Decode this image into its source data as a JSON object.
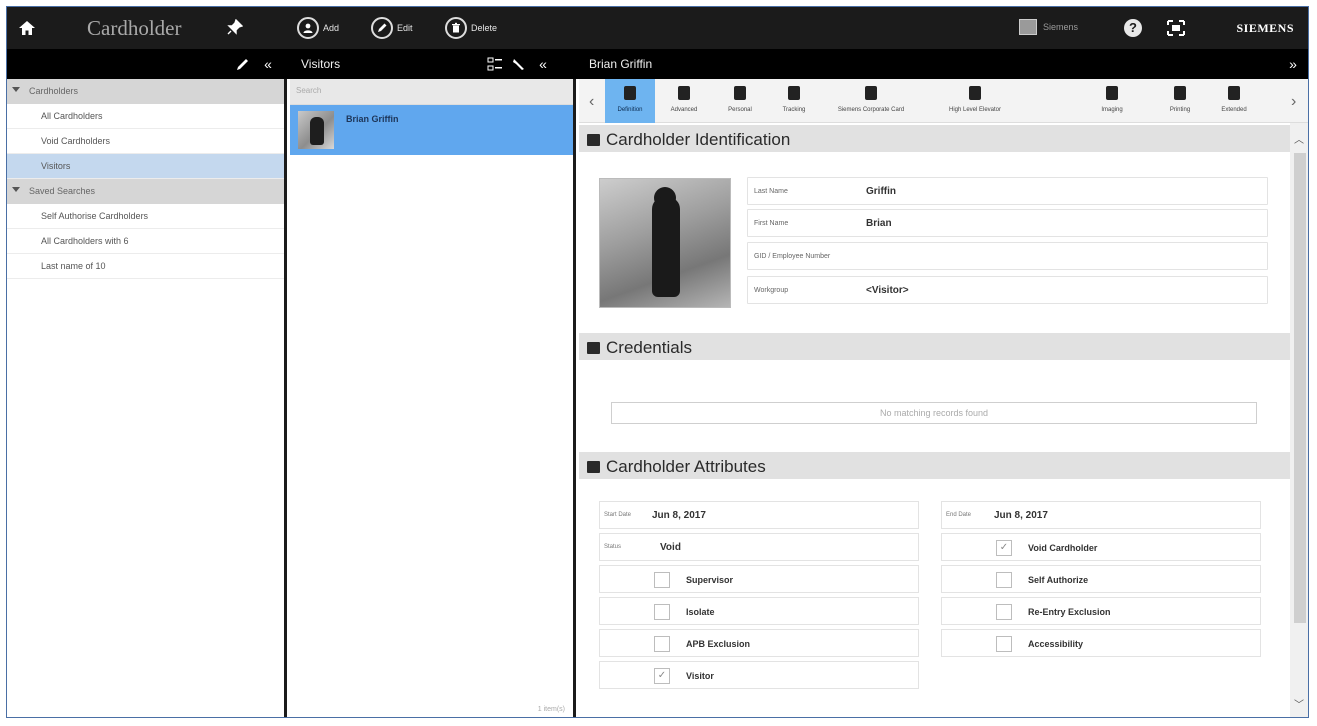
{
  "topbar": {
    "title": "Cardholder",
    "add_label": "Add",
    "edit_label": "Edit",
    "delete_label": "Delete",
    "user_name": "Siemens",
    "help_glyph": "?",
    "brand": "SIEMENS"
  },
  "subbar": {
    "list_title": "Visitors",
    "detail_title": "Brian Griffin"
  },
  "tree": {
    "group1": "Cardholders",
    "items1": [
      "All Cardholders",
      "Void Cardholders",
      "Visitors"
    ],
    "group2": "Saved Searches",
    "items2": [
      "Self Authorise Cardholders",
      "All Cardholders with 6",
      "Last name of 10"
    ]
  },
  "list": {
    "search_placeholder": "Search",
    "rows": [
      {
        "name": "Brian Griffin"
      }
    ],
    "count_text": "1 item(s)"
  },
  "tabs": [
    "Definition",
    "Advanced",
    "Personal",
    "Tracking",
    "Siemens Corporate Card",
    "High Level Elevator",
    "Imaging",
    "Printing",
    "Extended"
  ],
  "identification": {
    "header": "Cardholder Identification",
    "fields": [
      {
        "label": "Last Name",
        "value": "Griffin"
      },
      {
        "label": "First Name",
        "value": "Brian"
      },
      {
        "label": "GID / Employee Number",
        "value": ""
      },
      {
        "label": "Workgroup",
        "value": "<Visitor>"
      }
    ]
  },
  "credentials": {
    "header": "Credentials",
    "empty_text": "No matching records found"
  },
  "attributes": {
    "header": "Cardholder Attributes",
    "start_label": "Start Date",
    "start_value": "Jun 8, 2017",
    "end_label": "End Date",
    "end_value": "Jun 8, 2017",
    "status_label": "Status",
    "status_value": "Void",
    "left_checks": [
      {
        "label": "Supervisor",
        "checked": false
      },
      {
        "label": "Isolate",
        "checked": false
      },
      {
        "label": "APB Exclusion",
        "checked": false
      },
      {
        "label": "Visitor",
        "checked": true
      }
    ],
    "right_checks": [
      {
        "label": "Void Cardholder",
        "checked": true
      },
      {
        "label": "Self Authorize",
        "checked": false
      },
      {
        "label": "Re-Entry Exclusion",
        "checked": false
      },
      {
        "label": "Accessibility",
        "checked": false
      }
    ],
    "check_glyph": "✓"
  }
}
